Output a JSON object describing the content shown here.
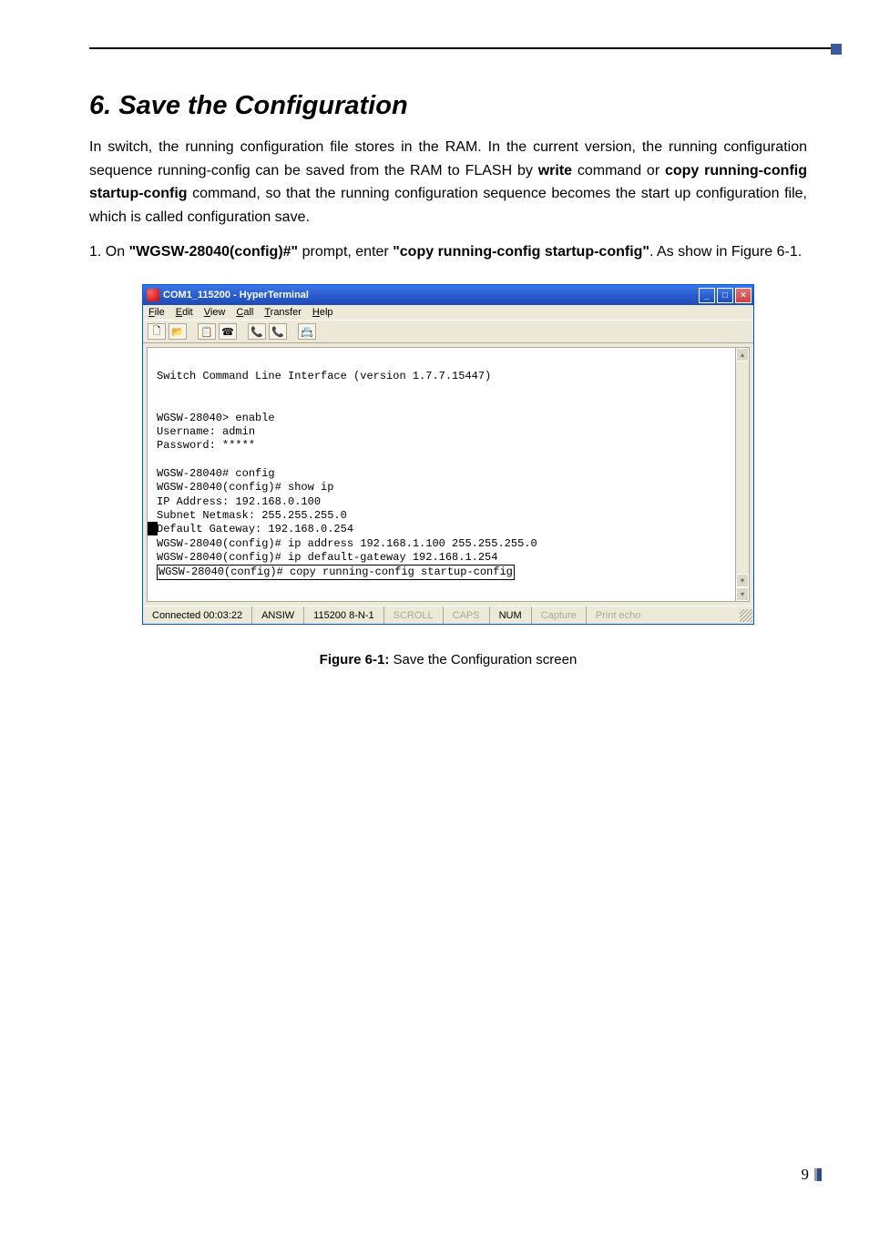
{
  "section": {
    "title": "6. Save the Configuration",
    "para1_pre": "In switch, the running configuration file stores in the RAM. In the current version, the running configuration sequence running-config can be saved from the RAM to FLASH by ",
    "bold_write": "write",
    "para1_mid1": " command or ",
    "bold_copy": "copy running-config startup-config",
    "para1_mid2": " command, so that the running configuration sequence becomes the start up configuration file, which is called configuration save.",
    "list1_num": "1. ",
    "list1_pre": "On ",
    "list1_b1": "\"WGSW-28040(config)#\"",
    "list1_mid": " prompt, enter ",
    "list1_b2": "\"copy running-config startup-config\"",
    "list1_post": ". As show in Figure 6-1."
  },
  "hyperterminal": {
    "title": "COM1_115200 - HyperTerminal",
    "menu": {
      "file": "File",
      "edit": "Edit",
      "view": "View",
      "call": "Call",
      "transfer": "Transfer",
      "help": "Help"
    },
    "toolbar": {
      "new": "🗋",
      "open": "📂",
      "snap": "📋",
      "phone": "☎",
      "call": "📞",
      "disc": "📞",
      "props": "📇"
    },
    "terminal": {
      "l1": "Switch Command Line Interface (version 1.7.7.15447)",
      "l2": "WGSW-28040> enable",
      "l3": "Username: admin",
      "l4": "Password: *****",
      "l5": "WGSW-28040# config",
      "l6": "WGSW-28040(config)# show ip",
      "l7": "IP Address: 192.168.0.100",
      "l8": "Subnet Netmask: 255.255.255.0",
      "l9": "Default Gateway: 192.168.0.254",
      "l10": "WGSW-28040(config)# ip address 192.168.1.100 255.255.255.0",
      "l11": "WGSW-28040(config)# ip default-gateway 192.168.1.254",
      "l12": "WGSW-28040(config)# copy running-config startup-config"
    },
    "status": {
      "connected": "Connected 00:03:22",
      "emul": "ANSIW",
      "params": "115200 8-N-1",
      "scroll": "SCROLL",
      "caps": "CAPS",
      "num": "NUM",
      "capture": "Capture",
      "echo": "Print echo"
    }
  },
  "caption": {
    "label": "Figure 6-1:",
    "text": "  Save the Configuration screen"
  },
  "pageNumber": "9"
}
